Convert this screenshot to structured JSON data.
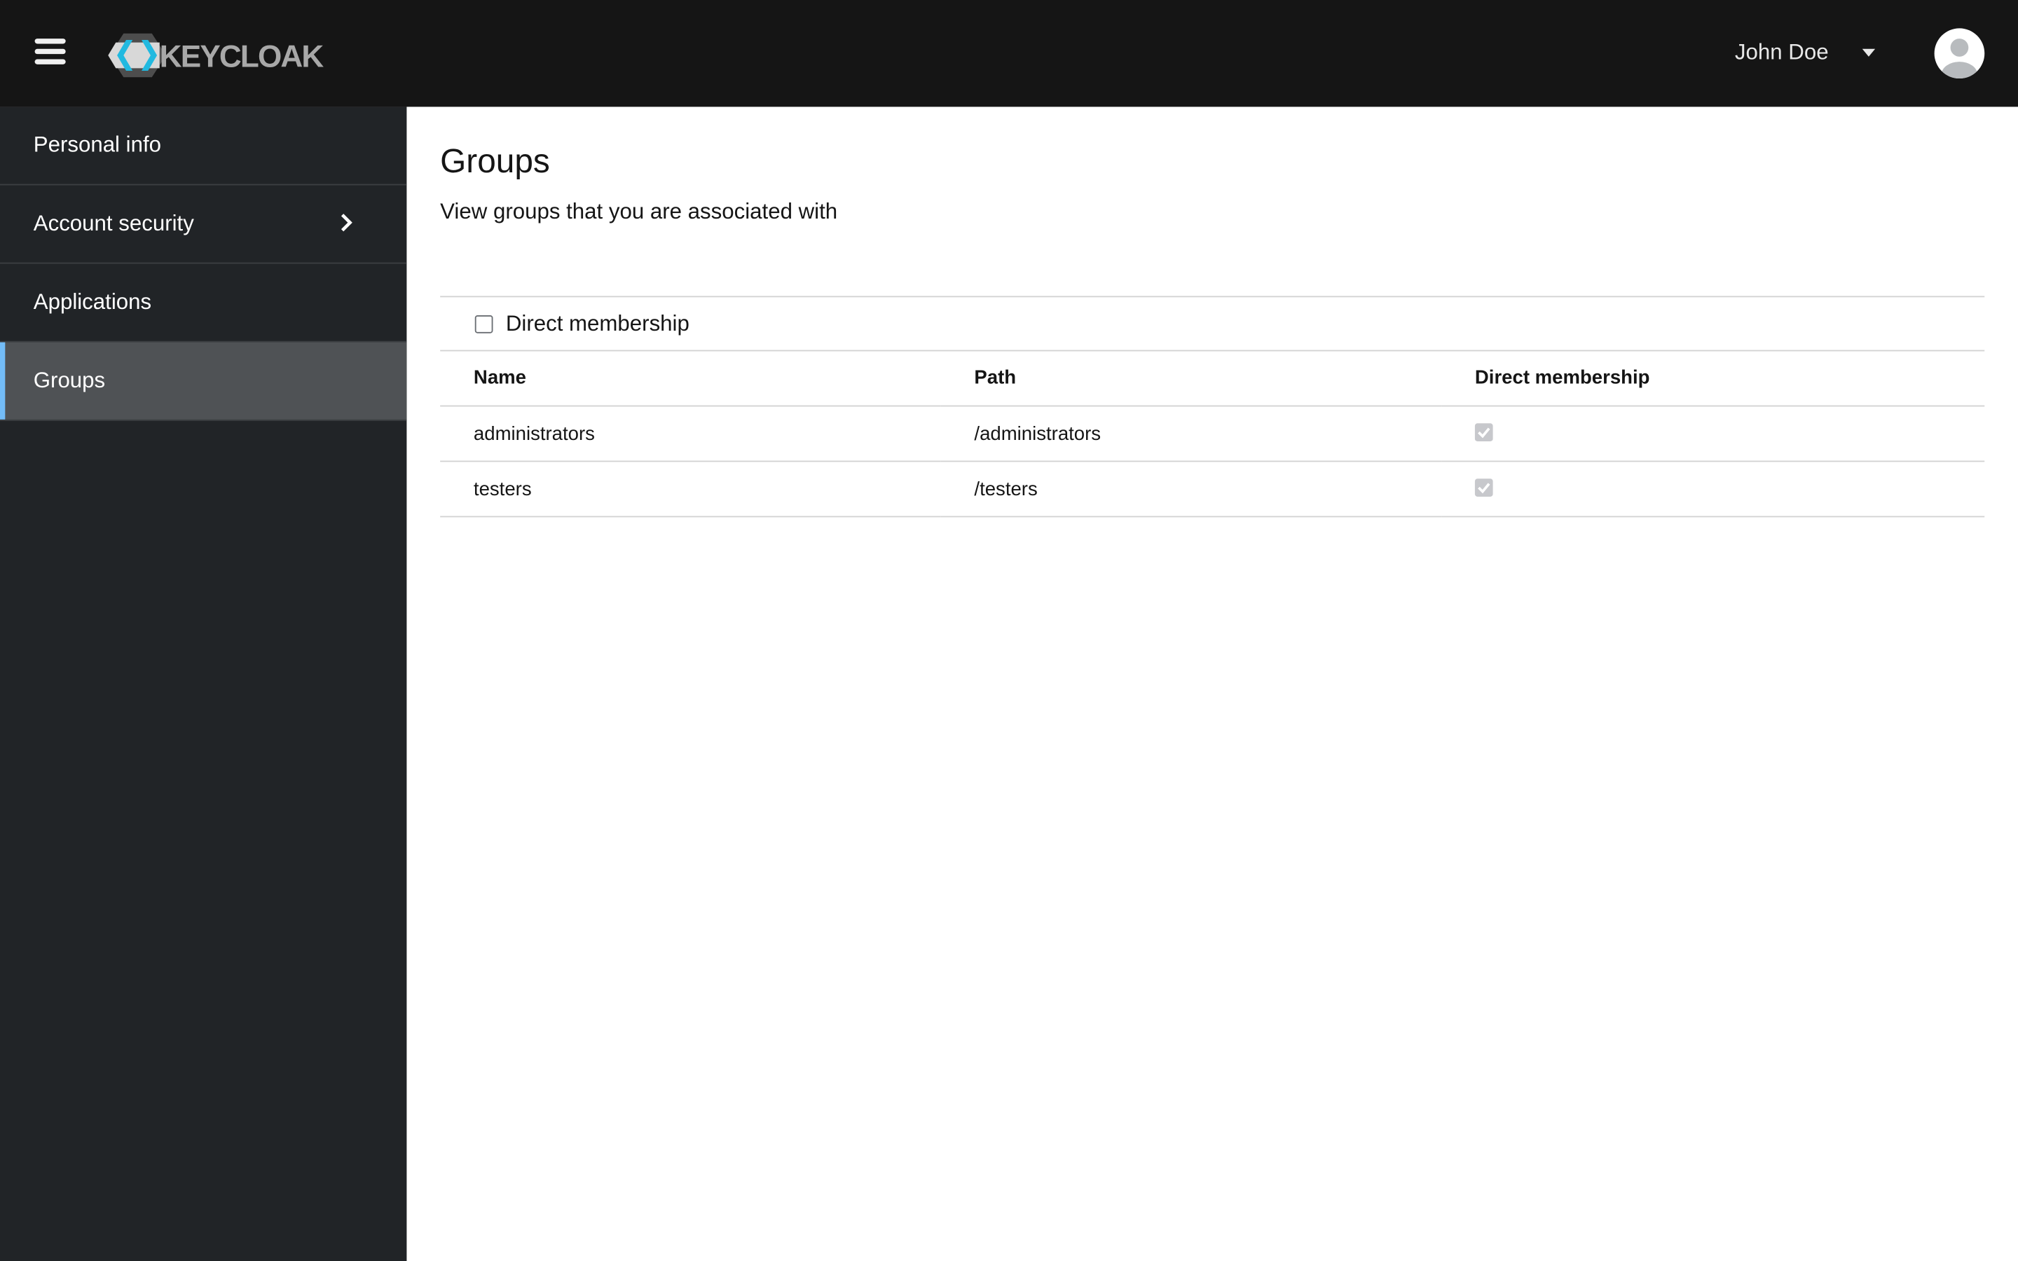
{
  "header": {
    "brand": "KEYCLOAK",
    "user_name": "John Doe"
  },
  "sidebar": {
    "items": [
      {
        "label": "Personal info"
      },
      {
        "label": "Account security"
      },
      {
        "label": "Applications"
      },
      {
        "label": "Groups"
      }
    ]
  },
  "main": {
    "title": "Groups",
    "subtitle": "View groups that you are associated with",
    "filter_label": "Direct membership",
    "columns": [
      "Name",
      "Path",
      "Direct membership"
    ],
    "rows": [
      {
        "name": "administrators",
        "path": "/administrators",
        "direct": true
      },
      {
        "name": "testers",
        "path": "/testers",
        "direct": true
      }
    ]
  },
  "colors": {
    "accent": "#73bcf7",
    "topbar": "#151515",
    "sidebar": "#212427"
  }
}
